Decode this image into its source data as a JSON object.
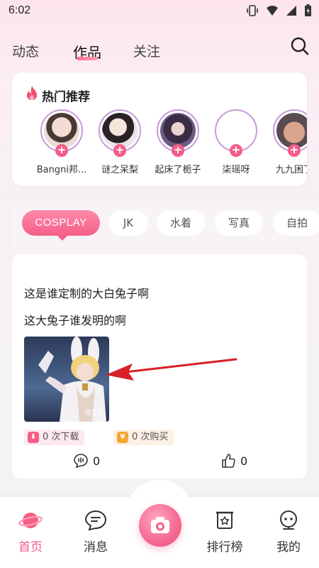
{
  "status_bar": {
    "time": "6:02"
  },
  "top_nav": {
    "tabs": [
      {
        "label": "动态"
      },
      {
        "label": "作品"
      },
      {
        "label": "关注"
      }
    ]
  },
  "hot": {
    "title": "热门推荐",
    "creators": [
      {
        "name": "Bangni邦..."
      },
      {
        "name": "谜之呆梨"
      },
      {
        "name": "起床了栀子"
      },
      {
        "name": "柒瑶呀"
      },
      {
        "name": "九九困了"
      }
    ]
  },
  "categories": [
    {
      "label": "COSPLAY"
    },
    {
      "label": "JK"
    },
    {
      "label": "水着"
    },
    {
      "label": "写真"
    },
    {
      "label": "自拍"
    }
  ],
  "post": {
    "line1": "这是谁定制的大白兔子啊",
    "line2": "这大兔子谁发明的啊",
    "duration": "0:16",
    "downloads": "0 次下载",
    "purchases": "0 次购买",
    "comments": "0",
    "likes": "0"
  },
  "bottom_nav": {
    "home": "首页",
    "messages": "消息",
    "ranking": "排行榜",
    "mine": "我的"
  },
  "colors": {
    "accent": "#f45d87",
    "accent_light": "#ff89a8",
    "purchase": "#f5a530"
  }
}
